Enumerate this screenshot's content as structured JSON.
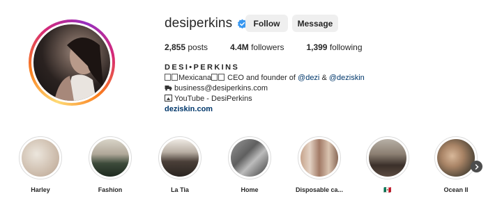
{
  "profile": {
    "username": "desiperkins",
    "verified_icon": "verified-badge-icon",
    "follow_label": "Follow",
    "message_label": "Message"
  },
  "stats": {
    "posts_count": "2,855",
    "posts_label": "posts",
    "followers_count": "4.4M",
    "followers_label": "followers",
    "following_count": "1,399",
    "following_label": "following"
  },
  "bio": {
    "display_name": "DESI•PERKINS",
    "line1_text": "Mexicana",
    "line1_rest": " CEO and founder of ",
    "mention1": "@dezi",
    "amp": " & ",
    "mention2": "@deziskin",
    "email": "business@desiperkins.com",
    "youtube": "YouTube - DesiPerkins",
    "website": "deziskin.com"
  },
  "highlights": [
    {
      "label": "Harley"
    },
    {
      "label": "Fashion"
    },
    {
      "label": "La Tia"
    },
    {
      "label": "Home"
    },
    {
      "label": "Disposable ca..."
    },
    {
      "label": "🇲🇽"
    },
    {
      "label": "Ocean II"
    }
  ],
  "colors": {
    "button_bg": "#efefef",
    "verified_blue": "#3897f0",
    "link_blue": "#00376b",
    "text": "#262626"
  }
}
